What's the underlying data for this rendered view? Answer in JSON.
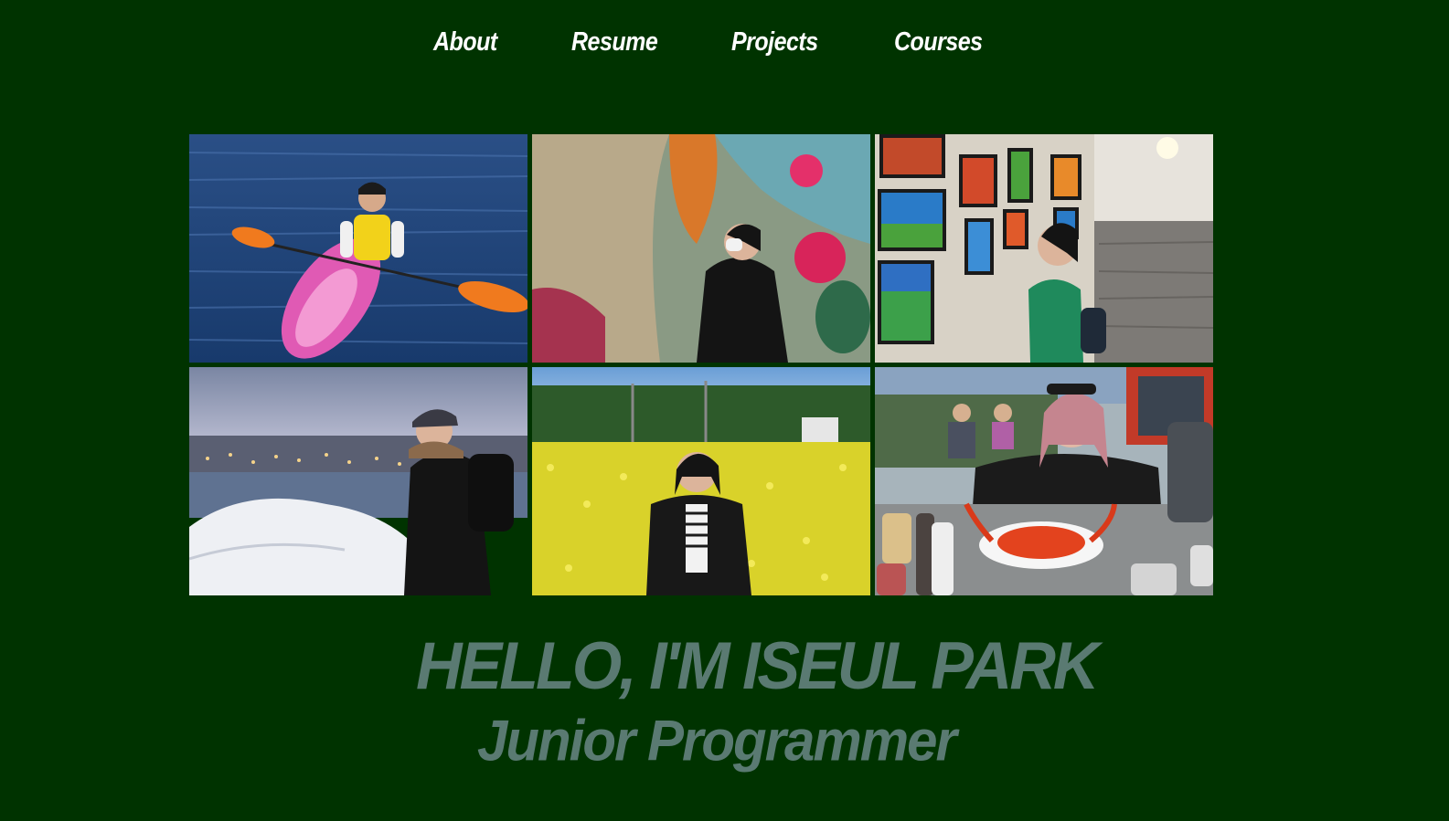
{
  "nav": {
    "items": [
      {
        "label": "About"
      },
      {
        "label": "Resume"
      },
      {
        "label": "Projects"
      },
      {
        "label": "Courses"
      }
    ]
  },
  "gallery": {
    "photos": [
      {
        "icon": "kayak-photo"
      },
      {
        "icon": "mural-photo"
      },
      {
        "icon": "gallery-paintings-photo"
      },
      {
        "icon": "snowy-harbor-photo"
      },
      {
        "icon": "flower-field-photo"
      },
      {
        "icon": "lobster-dinner-photo"
      }
    ]
  },
  "hero": {
    "title": "HELLO, I'M ISEUL PARK",
    "subtitle": "Junior Programmer"
  },
  "colors": {
    "background": "#003300",
    "nav_text": "#ffffff",
    "hero_text": "#5a7a72"
  }
}
